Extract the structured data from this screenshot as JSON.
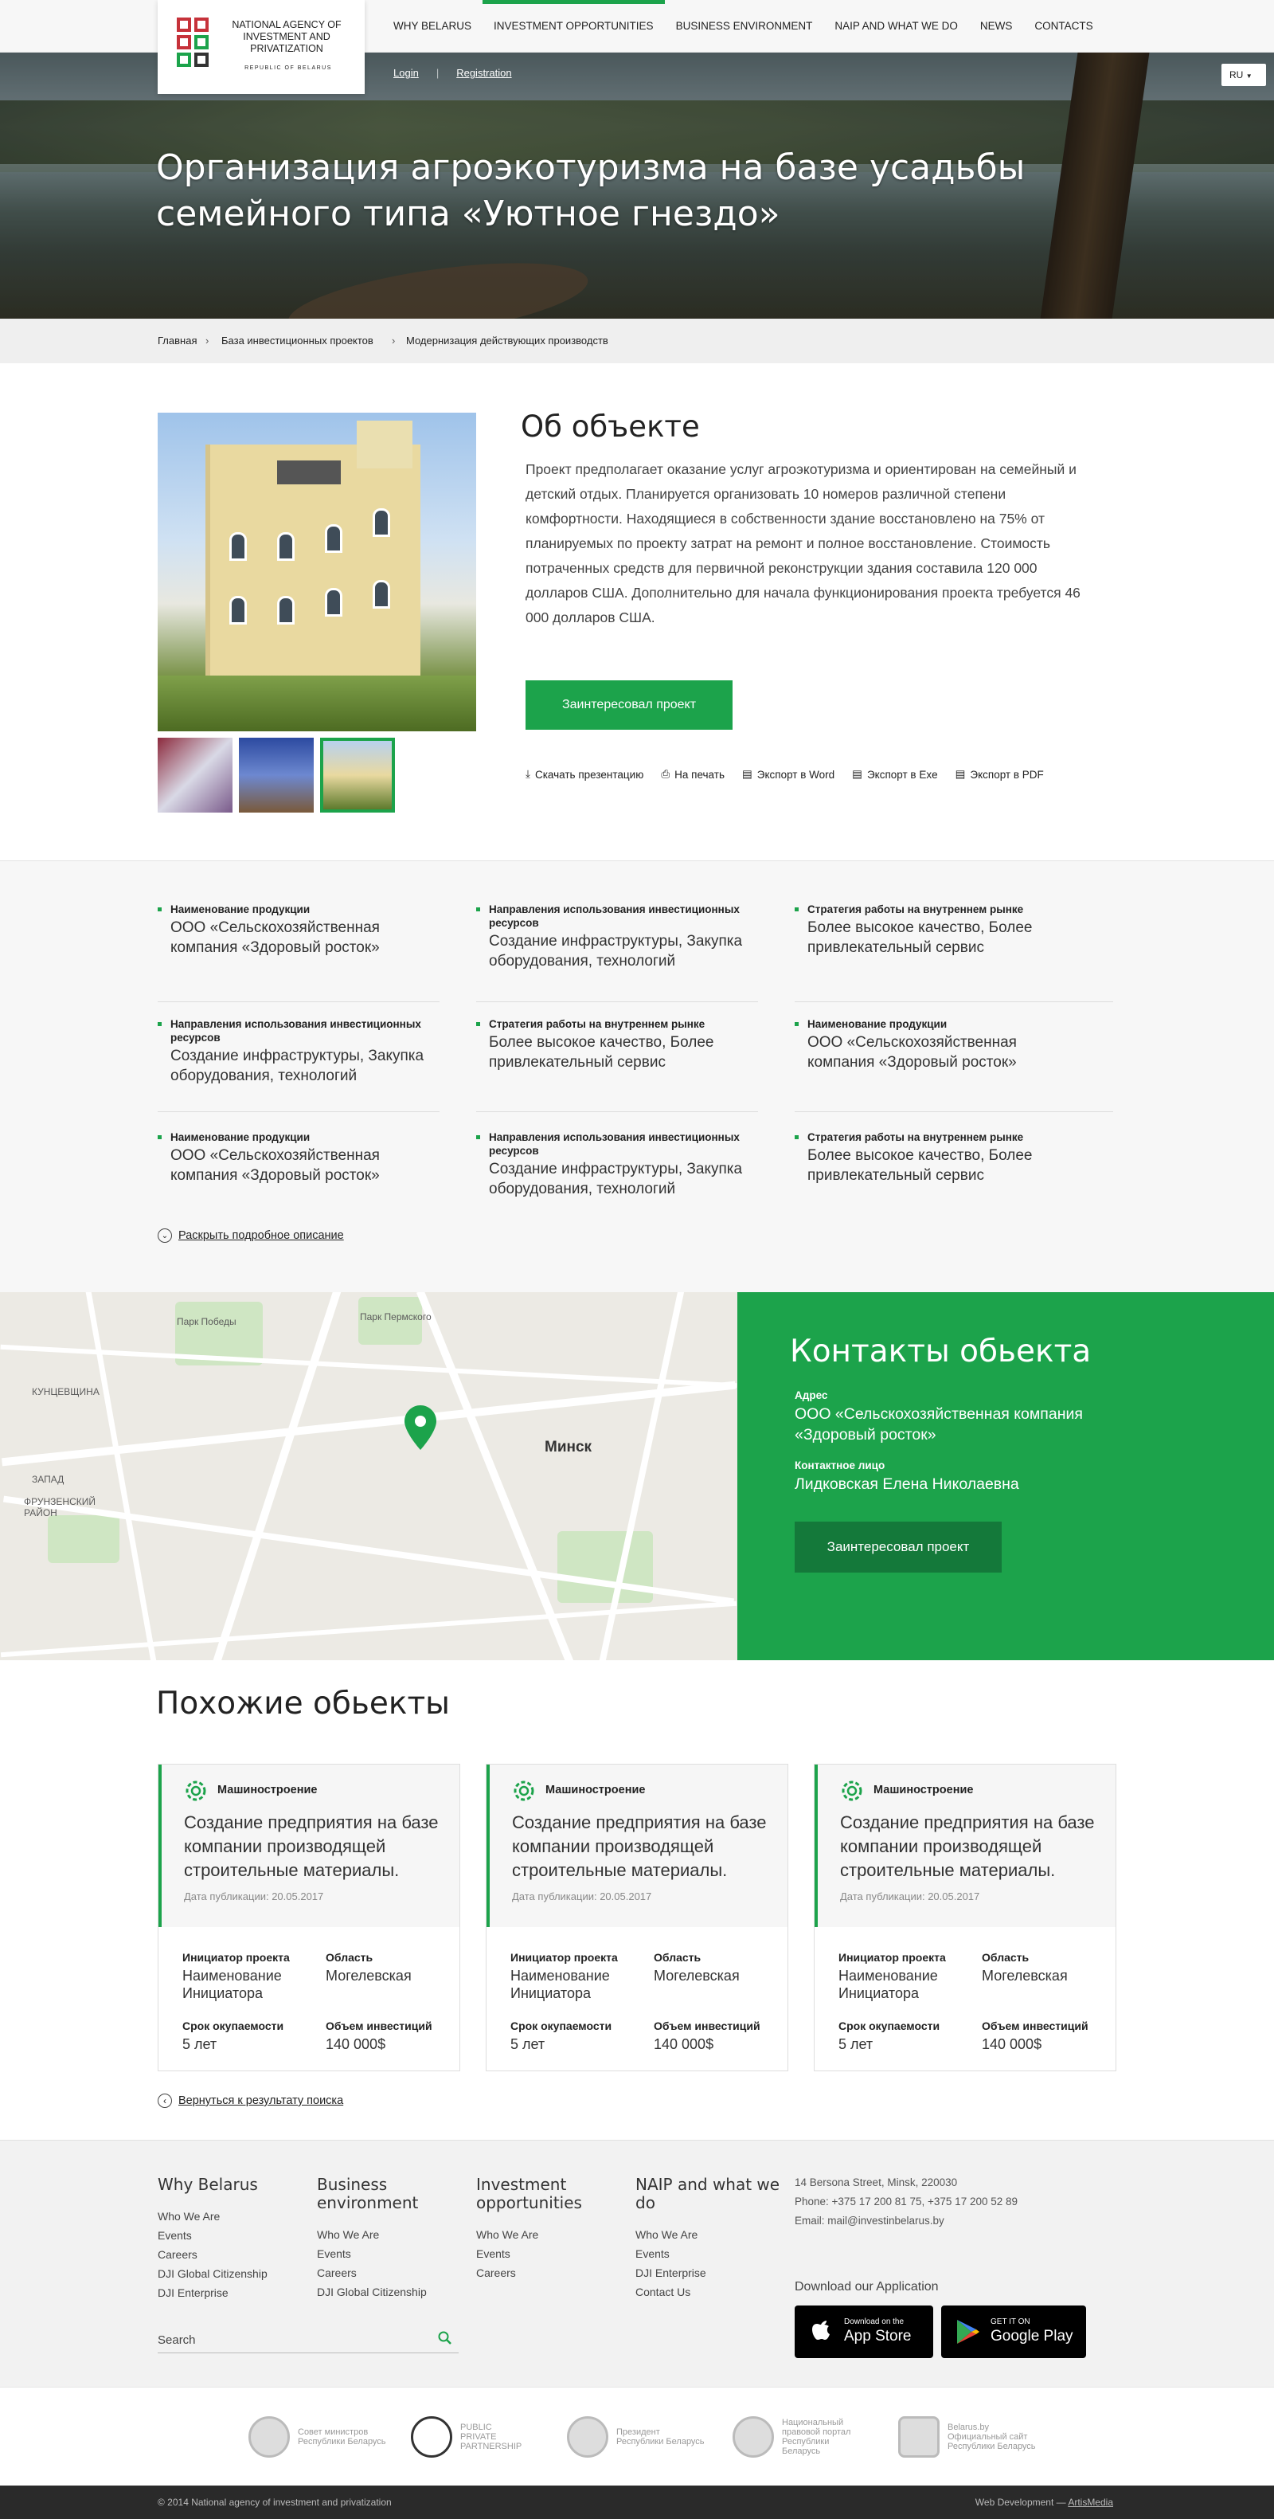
{
  "header": {
    "logo_text": "National Agency of Investment and Privatization",
    "logo_sub": "REPUBLIC OF BELARUS",
    "nav": [
      {
        "label": "WHY BELARUS"
      },
      {
        "label": "INVESTMENT OPPORTUNITIES",
        "active": true
      },
      {
        "label": "BUSINESS ENVIRONMENT"
      },
      {
        "label": "NAIP AND WHAT WE DO"
      },
      {
        "label": "NEWS"
      },
      {
        "label": "CONTACTS"
      }
    ],
    "login": "Login",
    "registration": "Registration",
    "lang": "RU"
  },
  "hero": {
    "title": "Организация агроэкотуризма на базе усадьбы семейного типа «Уютное гнездо»"
  },
  "breadcrumb": [
    "Главная",
    "База инвестиционных проектов",
    "Модернизация действующих производств"
  ],
  "about": {
    "title": "Об объекте",
    "text": "Проект предполагает оказание услуг агроэкотуризма и ориентирован на семейный и детский отдых. Планируется организовать 10 номеров различной степени комфортности. Находящиеся в собственности здание восстановлено на 75% от планируемых по проекту затрат на ремонт и полное восстановление. Стоимость потраченных средств для первичной реконструкции здания составила 120 000 долларов США. Дополнительно для начала функционирования проекта требуется 46 000 долларов США.",
    "button": "Заинтересовал проект",
    "actions": [
      {
        "label": "Скачать презентацию",
        "icon": "download-icon"
      },
      {
        "label": "На печать",
        "icon": "print-icon"
      },
      {
        "label": "Экспорт в Word",
        "icon": "document-icon"
      },
      {
        "label": "Экспорт в Exe",
        "icon": "document-icon"
      },
      {
        "label": "Экспорт в PDF",
        "icon": "pdf-icon"
      }
    ]
  },
  "specs": [
    {
      "label": "Наименование продукции",
      "value": "ООО «Сельскохозяйственная компания «Здоровый росток»"
    },
    {
      "label": "Направления использования инвестиционных ресурсов",
      "value": "Создание инфраструктуры, Закупка оборудования, технологий"
    },
    {
      "label": "Стратегия работы на внутреннем рынке",
      "value": "Более высокое качество, Более привлекательный сервис"
    },
    {
      "label": "Направления использования инвестиционных ресурсов",
      "value": "Создание инфраструктуры, Закупка оборудования, технологий"
    },
    {
      "label": "Стратегия работы на внутреннем рынке",
      "value": "Более высокое качество, Более привлекательный сервис"
    },
    {
      "label": "Наименование продукции",
      "value": "ООО «Сельскохозяйственная компания «Здоровый росток»"
    },
    {
      "label": "Наименование продукции",
      "value": "ООО «Сельскохозяйственная компания «Здоровый росток»"
    },
    {
      "label": "Направления использования инвестиционных ресурсов",
      "value": "Создание инфраструктуры, Закупка оборудования, технологий"
    },
    {
      "label": "Стратегия работы на внутреннем рынке",
      "value": "Более высокое качество, Более привлекательный сервис"
    }
  ],
  "expand_label": "Раскрыть подробное описание",
  "map": {
    "city": "Минск",
    "labels": [
      "Парк Победы",
      "КУНЦЕВЩИНА",
      "ЗАПАД",
      "ФРУНЗЕНСКИЙ РАЙОН",
      "Парк Пермского"
    ]
  },
  "contacts": {
    "title": "Контакты обьекта",
    "address_label": "Адрес",
    "address": "ООО «Сельскохозяйственная компания «Здоровый росток»",
    "person_label": "Контактное лицо",
    "person": "Лидковская Елена Николаевна",
    "button": "Заинтересовал проект"
  },
  "similar": {
    "title": "Похожие обьекты",
    "cards": [
      {
        "category": "Машиностроение",
        "title": "Создание предприятия на базе компании производящей строительные материалы.",
        "date": "Дата публикации: 20.05.2017",
        "initiator_label": "Инициатор проекта",
        "initiator": "Наименование Инициатора",
        "region_label": "Область",
        "region": "Могелевская",
        "payback_label": "Срок окупаемости",
        "payback": "5 лет",
        "invest_label": "Объем инвестиций",
        "invest": "140 000$"
      },
      {
        "category": "Машиностроение",
        "title": "Создание предприятия на базе компании производящей строительные материалы.",
        "date": "Дата публикации: 20.05.2017",
        "initiator_label": "Инициатор проекта",
        "initiator": "Наименование Инициатора",
        "region_label": "Область",
        "region": "Могелевская",
        "payback_label": "Срок окупаемости",
        "payback": "5 лет",
        "invest_label": "Объем инвестиций",
        "invest": "140 000$"
      },
      {
        "category": "Машиностроение",
        "title": "Создание предприятия на базе компании производящей строительные материалы.",
        "date": "Дата публикации: 20.05.2017",
        "initiator_label": "Инициатор проекта",
        "initiator": "Наименование Инициатора",
        "region_label": "Область",
        "region": "Могелевская",
        "payback_label": "Срок окупаемости",
        "payback": "5 лет",
        "invest_label": "Объем инвестиций",
        "invest": "140 000$"
      }
    ],
    "back": "Вернуться к результату поиска"
  },
  "footer": {
    "cols": [
      {
        "title": "Why Belarus",
        "links": [
          "Who We Are",
          "Events",
          "Careers",
          "DJI Global Citizenship",
          "DJI Enterprise"
        ]
      },
      {
        "title": "Business environment",
        "links": [
          "Who We Are",
          "Events",
          "Careers",
          "DJI Global Citizenship"
        ]
      },
      {
        "title": "Investment opportunities",
        "links": [
          "Who We Are",
          "Events",
          "Careers"
        ]
      },
      {
        "title": "NAIP and what we do",
        "links": [
          "Who We Are",
          "Events",
          "DJI Enterprise",
          "Contact Us"
        ]
      }
    ],
    "search_placeholder": "Search",
    "address": "14 Bersona Street, Minsk, 220030",
    "phone": "Phone: +375 17 200 81 75,  +375 17 200 52 89",
    "email": "Email: mail@investinbelarus.by",
    "download": "Download our Application",
    "appstore_top": "Download on the",
    "appstore": "App Store",
    "gplay_top": "GET IT ON",
    "gplay": "Google Play",
    "partners": [
      {
        "name": "Совет министров",
        "sub": "Республики Беларусь"
      },
      {
        "name": "PUBLIC PRIVATE PARTNERSHIP",
        "sub": ""
      },
      {
        "name": "Президент",
        "sub": "Республики Беларусь"
      },
      {
        "name": "Национальный правовой портал",
        "sub": "Республики Беларусь"
      },
      {
        "name": "Belarus.by",
        "sub": "Официальный сайт Республики Беларусь"
      }
    ],
    "copyright": "© 2014 National agency of investment and privatization",
    "dev_prefix": "Web Development — ",
    "dev": "ArtisMedia"
  },
  "colors": {
    "accent": "#1ca34b",
    "accent_dark": "#14793a"
  }
}
